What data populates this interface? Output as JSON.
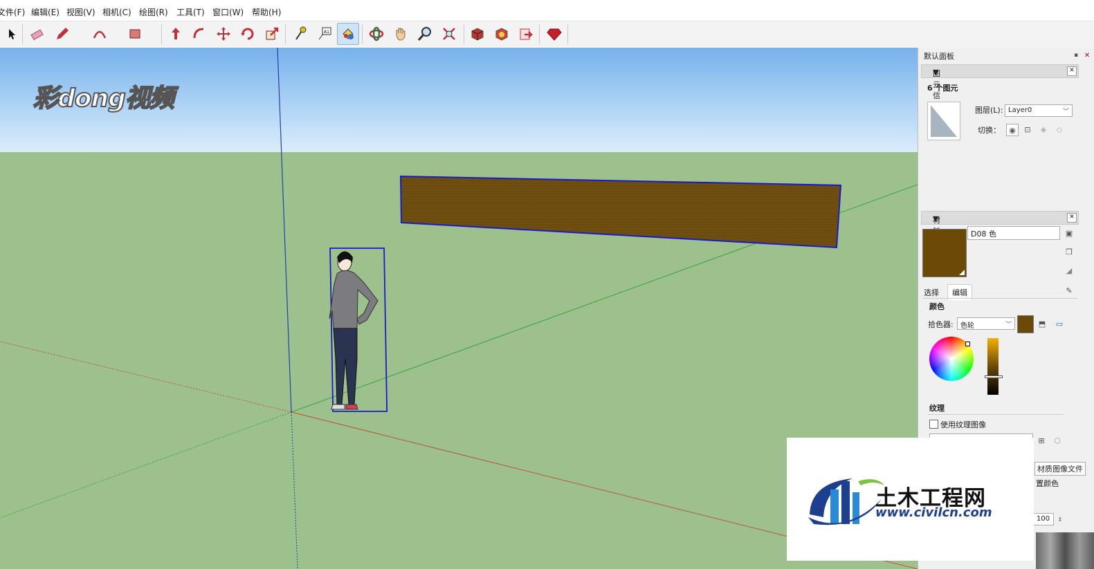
{
  "menu": {
    "items": [
      "文件(F)",
      "编辑(E)",
      "视图(V)",
      "相机(C)",
      "绘图(R)",
      "工具(T)",
      "窗口(W)",
      "帮助(H)"
    ]
  },
  "toolbar": {
    "tools": [
      "select-tool",
      "eraser-tool",
      "pencil-tool",
      "arc-tool",
      "rectangle-tool",
      "push-pull-tool",
      "follow-me-tool",
      "move-tool",
      "rotate-tool",
      "scale-tool",
      "tape-measure-tool",
      "text-tool",
      "paint-bucket-tool",
      "orbit-tool",
      "pan-tool",
      "zoom-tool",
      "zoom-extents-tool",
      "warehouse-tool",
      "extension-warehouse-tool",
      "send-to-layout-tool",
      "ruby-console-tool"
    ],
    "active_tool": "paint-bucket-tool"
  },
  "viewport": {
    "sky_color_top": "#75b2ec",
    "sky_color_bottom": "#dceefb",
    "ground_color": "#9dc18d",
    "wall_color": "#6b4c0e",
    "selection_color": "#1a1acc",
    "watermark": "彩dong视频"
  },
  "logo": {
    "name": "土木工程网",
    "url": "www.civilcn.com"
  },
  "tray": {
    "title": "默认面板",
    "entity_info": {
      "header": "图元信息",
      "summary": "6 个图元",
      "layer_label": "图层(L):",
      "layer_value": "Layer0",
      "toggle_label": "切换："
    },
    "materials": {
      "header": "材料",
      "material_name": "D08 色",
      "swatch_color": "#6b4a08",
      "tabs": [
        "选择",
        "编辑"
      ],
      "active_tab": "编辑",
      "color_section": "颜色",
      "picker_label": "拾色器:",
      "picker_value": "色轮",
      "texture_section": "纹理",
      "use_texture_label": "使用纹理图像",
      "use_texture_checked": false,
      "tooltip_fragment": "材质图像文件",
      "reset_fragment": "置颜色",
      "opacity_value": "100"
    }
  }
}
